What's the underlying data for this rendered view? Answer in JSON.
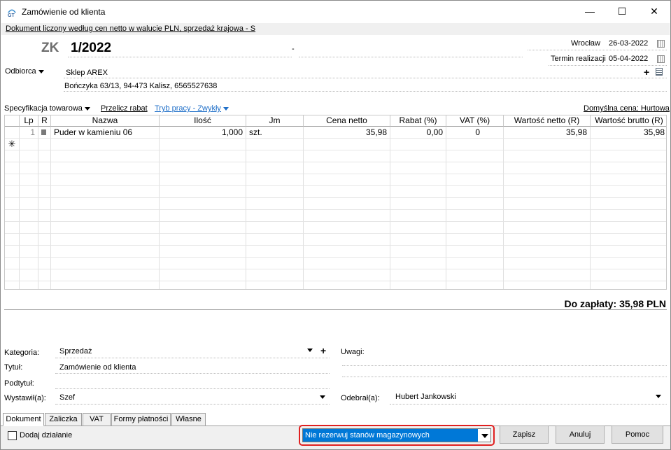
{
  "window": {
    "title": "Zamówienie od klienta",
    "minimize": "—",
    "maximize": "☐",
    "close": "✕"
  },
  "infobar": "Dokument liczony według cen netto w walucie PLN, sprzedaż krajowa - S",
  "document": {
    "type": "ZK",
    "number": "1/2022",
    "dash": "-",
    "place": "Wrocław",
    "date": "26-03-2022",
    "due_label": "Termin realizacji",
    "due_date": "05-04-2022"
  },
  "customer": {
    "label": "Odbiorca",
    "name": "Sklep AREX",
    "address": "Bończyka  63/13, 94-473 Kalisz, 6565527638"
  },
  "toolbar": {
    "spec": "Specyfikacja towarowa",
    "recalc": "Przelicz rabat",
    "mode": "Tryb pracy - Zwykły",
    "default_price": "Domyślna cena: Hurtowa"
  },
  "table": {
    "headers": [
      "Lp",
      "R",
      "Nazwa",
      "Ilość",
      "Jm",
      "Cena netto",
      "Rabat (%)",
      "VAT (%)",
      "Wartość netto (R)",
      "Wartość brutto (R)"
    ],
    "rows": [
      {
        "lp": "1",
        "name": "Puder w kamieniu 06",
        "qty": "1,000",
        "unit": "szt.",
        "price": "35,98",
        "discount": "0,00",
        "vat": "0",
        "net": "35,98",
        "gross": "35,98"
      }
    ],
    "new_row_marker": "✳"
  },
  "total": "Do zapłaty: 35,98 PLN",
  "form": {
    "category_label": "Kategoria:",
    "category": "Sprzedaż",
    "title_label": "Tytuł:",
    "title": "Zamówienie od klienta",
    "subtitle_label": "Podtytuł:",
    "issued_label": "Wystawił(a):",
    "issued": "Szef",
    "notes_label": "Uwagi:",
    "received_label": "Odebrał(a):",
    "received": "Hubert Jankowski"
  },
  "tabs": [
    "Dokument",
    "Zaliczka",
    "VAT",
    "Formy płatności",
    "Własne"
  ],
  "footer": {
    "add_action": "Dodaj działanie",
    "reservation": "Nie rezerwuj stanów magazynowych",
    "save": "Zapisz",
    "cancel": "Anuluj",
    "help": "Pomoc"
  }
}
